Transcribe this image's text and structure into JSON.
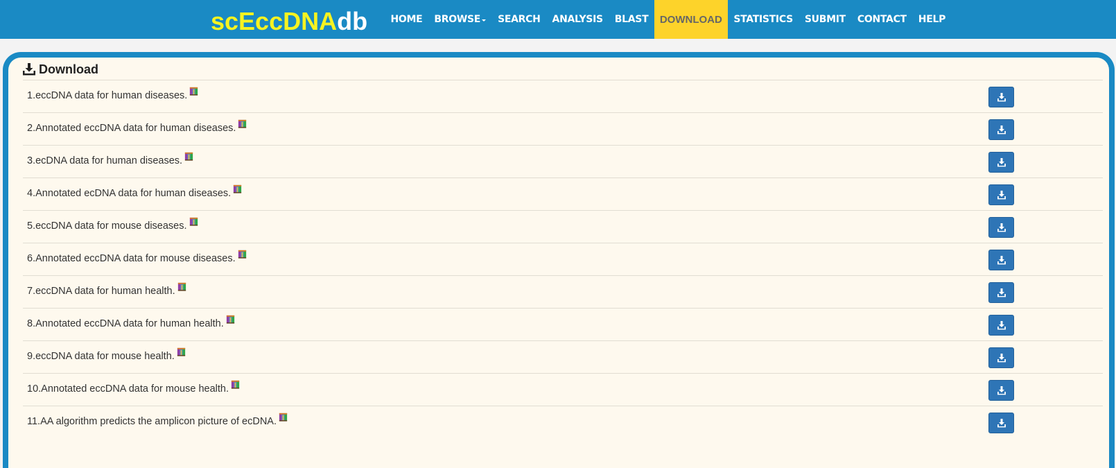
{
  "navbar": {
    "brand_part1": "scEccDNA",
    "brand_part2": "db",
    "items": [
      {
        "label": "HOME"
      },
      {
        "label": "BROWSE"
      },
      {
        "label": "SEARCH"
      },
      {
        "label": "ANALYSIS"
      },
      {
        "label": "BLAST"
      },
      {
        "label": "DOWNLOAD"
      },
      {
        "label": "STATISTICS"
      },
      {
        "label": "SUBMIT"
      },
      {
        "label": "CONTACT"
      },
      {
        "label": "HELP"
      }
    ],
    "active": "DOWNLOAD"
  },
  "panel": {
    "title": "Download",
    "title_icon": "download-icon"
  },
  "downloads": [
    {
      "label": "1.eccDNA data for human diseases."
    },
    {
      "label": "2.Annotated eccDNA data for human diseases."
    },
    {
      "label": "3.ecDNA data for human diseases."
    },
    {
      "label": "4.Annotated ecDNA data for human diseases."
    },
    {
      "label": "5.eccDNA data for mouse diseases."
    },
    {
      "label": "6.Annotated eccDNA data for mouse diseases."
    },
    {
      "label": "7.eccDNA data for human health."
    },
    {
      "label": "8.Annotated eccDNA data for human health."
    },
    {
      "label": "9.eccDNA data for mouse health."
    },
    {
      "label": "10.Annotated eccDNA data for mouse health."
    },
    {
      "label": "11.AA algorithm predicts the amplicon picture of ecDNA."
    }
  ],
  "colors": {
    "navbar": "#1a8ac4",
    "brand_accent": "#f7f321",
    "active_tab": "#fdd32a",
    "panel_bg": "#fef9ee",
    "button": "#2e75b6"
  }
}
